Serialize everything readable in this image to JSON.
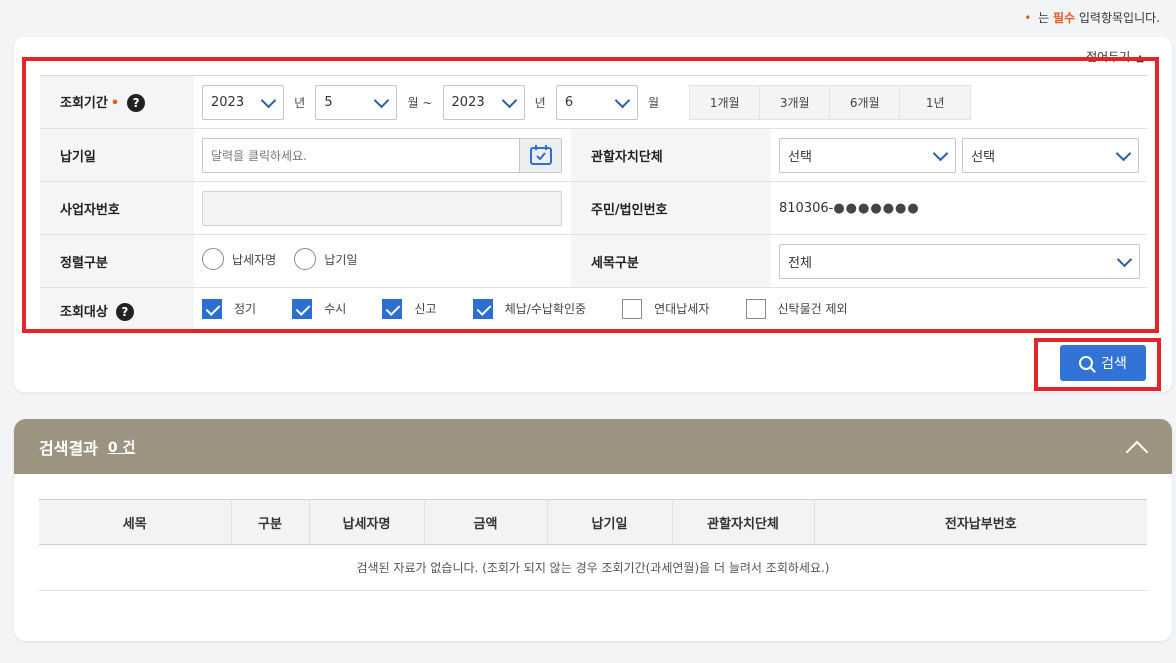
{
  "required_note": {
    "dot": "•",
    "prefix": "는",
    "emphasis": "필수",
    "suffix": "입력항목입니다."
  },
  "collapse_label": "접어두기",
  "form": {
    "period": {
      "label": "조회기간",
      "req_dot": "•",
      "start_year": "2023",
      "start_month": "5",
      "end_year": "2023",
      "end_month": "6",
      "unit_year": "년",
      "unit_month_range": "월 ~",
      "unit_month": "월",
      "quick_buttons": [
        "1개월",
        "3개월",
        "6개월",
        "1년"
      ]
    },
    "pay_date": {
      "label": "납기일",
      "placeholder": "달력을 클릭하세요."
    },
    "jurisdiction": {
      "label": "관할자치단체",
      "select1": "선택",
      "select2": "선택"
    },
    "business_no": {
      "label": "사업자번호",
      "value": ""
    },
    "resident_no": {
      "label": "주민/법인번호",
      "prefix": "810306-",
      "masked": "●●●●●●●"
    },
    "sort": {
      "label": "정렬구분",
      "options": [
        "납세자명",
        "납기일"
      ]
    },
    "tax_category": {
      "label": "세목구분",
      "value": "전체"
    },
    "target": {
      "label": "조회대상",
      "checkboxes": [
        {
          "label": "정기",
          "checked": true
        },
        {
          "label": "수시",
          "checked": true
        },
        {
          "label": "신고",
          "checked": true
        },
        {
          "label": "체납/수납확인중",
          "checked": true
        },
        {
          "label": "연대납세자",
          "checked": false
        },
        {
          "label": "신탁물건 제외",
          "checked": false
        }
      ]
    },
    "help_icon": "?"
  },
  "search_button": "검색",
  "results": {
    "title": "검색결과",
    "count": "0 건",
    "columns": [
      "세목",
      "구분",
      "납세자명",
      "금액",
      "납기일",
      "관할자치단체",
      "전자납부번호"
    ],
    "empty_message": "검색된 자료가 없습니다. (조회가 되지 않는 경우 조회기간(과세연월)을 더 늘려서 조회하세요.)"
  },
  "colors": {
    "accent": "#3174d6",
    "required": "#e8572a",
    "result_header": "#9c9381",
    "highlight": "#e3242b"
  }
}
